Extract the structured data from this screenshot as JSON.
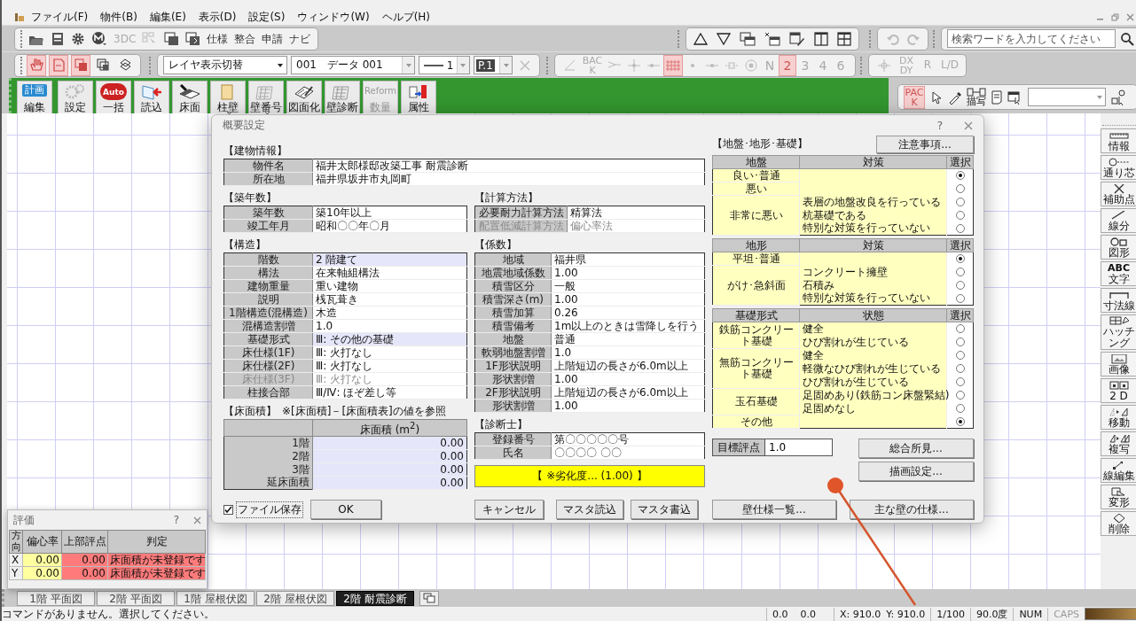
{
  "menu": {
    "items": [
      "ファイル(F)",
      "物件(B)",
      "編集(E)",
      "表示(D)",
      "設定(S)",
      "ウィンドウ(W)",
      "ヘルプ(H)"
    ]
  },
  "toolbar_top": {
    "text_buttons": [
      {
        "label": "3DC",
        "disabled": true
      },
      {
        "label": "仕様",
        "disabled": false
      },
      {
        "label": "整合",
        "disabled": false
      },
      {
        "label": "申請",
        "disabled": false
      },
      {
        "label": "ナビ",
        "disabled": false
      }
    ],
    "search": {
      "placeholder": "検索ワードを入力してください"
    }
  },
  "toolbar_second": {
    "mode_buttons": [
      {
        "selected": true
      },
      {
        "selected": true
      },
      {
        "selected": true
      },
      {
        "selected": false
      },
      {
        "selected": false
      }
    ],
    "layer_select": "レイヤ表示切替",
    "data_select": "001　データ 001",
    "line_select": "1",
    "page_select": "P.1",
    "snap_items": [
      {
        "kind": "icon",
        "selected": false
      },
      {
        "kind": "text",
        "label": "BACK",
        "selected": false
      },
      {
        "kind": "icon",
        "selected": false
      },
      {
        "kind": "icon",
        "selected": false
      },
      {
        "kind": "icon",
        "selected": false
      },
      {
        "kind": "icon",
        "selected": true
      },
      {
        "kind": "icon",
        "selected": false
      },
      {
        "kind": "icon",
        "selected": false
      },
      {
        "kind": "icon",
        "selected": false
      },
      {
        "kind": "icon",
        "selected": false
      },
      {
        "kind": "text",
        "label": "N",
        "selected": false
      },
      {
        "kind": "text",
        "label": "2",
        "selected": true
      },
      {
        "kind": "text",
        "label": "3",
        "selected": false
      },
      {
        "kind": "text",
        "label": "4",
        "selected": false
      },
      {
        "kind": "text",
        "label": "6",
        "selected": false
      }
    ],
    "offset_buttons": [
      "DX DY",
      "R",
      "L/D"
    ]
  },
  "ribbon": {
    "items": [
      {
        "label": "編集",
        "kind": "plan",
        "badge": "計画",
        "disabled": false,
        "dropdown": false
      },
      {
        "label": "設定",
        "kind": "icon",
        "disabled": false,
        "dropdown": false
      },
      {
        "label": "一括",
        "kind": "auto",
        "badge": "Auto",
        "disabled": false,
        "dropdown": false
      },
      {
        "label": "読込",
        "kind": "icon",
        "disabled": false,
        "dropdown": false
      },
      {
        "label": "床面",
        "kind": "icon",
        "disabled": false,
        "dropdown": false
      },
      {
        "label": "柱壁",
        "kind": "icon",
        "disabled": false,
        "dropdown": true
      },
      {
        "label": "壁番号",
        "kind": "icon",
        "disabled": false,
        "dropdown": true
      },
      {
        "label": "図面化",
        "kind": "icon",
        "disabled": false,
        "dropdown": false
      },
      {
        "label": "壁診断",
        "kind": "icon",
        "disabled": false,
        "dropdown": false
      },
      {
        "label": "数量",
        "kind": "reform",
        "badge": "Reform",
        "disabled": true,
        "dropdown": false
      },
      {
        "label": "属性",
        "kind": "icon",
        "disabled": false,
        "dropdown": false
      }
    ]
  },
  "ribbon_tools": {
    "pack": {
      "label": "PACK",
      "selected": true
    },
    "copy_label": "描写"
  },
  "dialog": {
    "title": "概要設定",
    "help": "?",
    "building_info": {
      "title": "【建物情報】",
      "rows": [
        {
          "label": "物件名",
          "value": "福井太郎様邸改築工事  耐震診断"
        },
        {
          "label": "所在地",
          "value": "福井県坂井市丸岡町"
        }
      ]
    },
    "age": {
      "title": "【築年数】",
      "rows": [
        {
          "label": "築年数",
          "value": "築10年以上"
        },
        {
          "label": "竣工年月",
          "value": "昭和〇〇年〇月"
        }
      ]
    },
    "calc_method": {
      "title": "【計算方法】",
      "rows": [
        {
          "label": "必要耐力計算方法",
          "value": "精算法",
          "disabled": false
        },
        {
          "label": "配置低減計算方法",
          "value": "偏心率法",
          "disabled": true
        }
      ]
    },
    "structure": {
      "title": "【構造】",
      "rows": [
        {
          "label": "階数",
          "value": "2 階建て",
          "selected": true,
          "disabled": false
        },
        {
          "label": "構法",
          "value": "在来軸組構法",
          "selected": false,
          "disabled": false
        },
        {
          "label": "建物重量",
          "value": "重い建物",
          "selected": false,
          "disabled": false
        },
        {
          "label": "説明",
          "value": "桟瓦葺き",
          "selected": false,
          "disabled": false
        },
        {
          "label": "1階構造(混構造)",
          "value": "木造",
          "selected": false,
          "disabled": false
        },
        {
          "label": "混構造割増",
          "value": "1.0",
          "selected": false,
          "disabled": false
        },
        {
          "label": "基礎形式",
          "value": "Ⅲ: その他の基礎",
          "selected": true,
          "disabled": false
        },
        {
          "label": "床仕様(1F)",
          "value": "Ⅲ: 火打なし",
          "selected": false,
          "disabled": false
        },
        {
          "label": "床仕様(2F)",
          "value": "Ⅲ: 火打なし",
          "selected": false,
          "disabled": false
        },
        {
          "label": "床仕様(3F)",
          "value": "Ⅲ: 火打なし",
          "selected": false,
          "disabled": true
        },
        {
          "label": "柱接合部",
          "value": "Ⅲ/Ⅳ: ほぞ差し等",
          "selected": false,
          "disabled": false
        }
      ]
    },
    "coefficients": {
      "title": "【係数】",
      "rows": [
        {
          "label": "地域",
          "value": "福井県"
        },
        {
          "label": "地震地域係数",
          "value": "1.00"
        },
        {
          "label": "積雪区分",
          "value": "一般"
        },
        {
          "label": "積雪深さ(m)",
          "value": "1.00"
        },
        {
          "label": "積雪加算",
          "value": "0.26"
        },
        {
          "label": "積雪備考",
          "value": "1m以上のときは雪降しを行う"
        },
        {
          "label": "地盤",
          "value": "普通"
        },
        {
          "label": "軟弱地盤割増",
          "value": "1.0"
        },
        {
          "label": "1F形状説明",
          "value": "上階短辺の長さが6.0m以上"
        },
        {
          "label": "形状割増",
          "value": "1.00"
        },
        {
          "label": "2F形状説明",
          "value": "上階短辺の長さが6.0m以上"
        },
        {
          "label": "形状割増",
          "value": "1.00"
        }
      ]
    },
    "floor_area": {
      "title": "【床面積】",
      "note": "※[床面積]－[床面積表]の値を参照",
      "header": "床面積 (m$^{2}$)",
      "rows": [
        {
          "label": "1階",
          "value": "0.00"
        },
        {
          "label": "2階",
          "value": "0.00"
        },
        {
          "label": "3階",
          "value": "0.00"
        },
        {
          "label": "延床面積",
          "value": "0.00"
        }
      ]
    },
    "inspector": {
      "title": "【診断士】",
      "rows": [
        {
          "label": "登録番号",
          "value": "第〇〇〇〇〇号"
        },
        {
          "label": "氏名",
          "value": "〇〇〇〇  〇〇"
        }
      ]
    },
    "deterioration": "【 ※劣化度... (1.00) 】",
    "foundation": {
      "title": "【地盤･地形･基礎】",
      "notes_button": "注意事項...",
      "tables": [
        {
          "headers": [
            "地盤",
            "対策",
            "選択"
          ],
          "groups": [
            {
              "label": "良い･普通",
              "rows": [
                {
                  "selected": true
                }
              ]
            },
            {
              "label": "悪い",
              "rows": [
                {
                  "selected": false
                }
              ]
            },
            {
              "label": "非常に悪い",
              "rows": [
                {
                  "text": "表層の地盤改良を行っている",
                  "selected": false
                },
                {
                  "text": "杭基礎である",
                  "selected": false
                },
                {
                  "text": "特別な対策を行っていない",
                  "selected": false
                }
              ]
            }
          ]
        },
        {
          "headers": [
            "地形",
            "対策",
            "選択"
          ],
          "groups": [
            {
              "label": "平坦･普通",
              "rows": [
                {
                  "selected": true
                }
              ]
            },
            {
              "label": "がけ･急斜面",
              "rows": [
                {
                  "text": "コンクリート擁壁",
                  "selected": false
                },
                {
                  "text": "石積み",
                  "selected": false
                },
                {
                  "text": "特別な対策を行っていない",
                  "selected": false
                }
              ]
            }
          ]
        },
        {
          "headers": [
            "基礎形式",
            "状態",
            "選択"
          ],
          "groups": [
            {
              "label": "鉄筋コンクリート基礎",
              "rows": [
                {
                  "text": "健全",
                  "selected": false
                },
                {
                  "text": "ひび割れが生じている",
                  "selected": false
                }
              ]
            },
            {
              "label": "無筋コンクリート基礎",
              "rows": [
                {
                  "text": "健全",
                  "selected": false
                },
                {
                  "text": "軽微なひび割れが生じている",
                  "selected": false
                },
                {
                  "text": "ひび割れが生じている",
                  "selected": false
                }
              ]
            },
            {
              "label": "玉石基礎",
              "rows": [
                {
                  "text": "足固めあり(鉄筋コン床盤緊結)",
                  "selected": false
                },
                {
                  "text": "足固めなし",
                  "selected": false
                }
              ]
            },
            {
              "label": "その他",
              "rows": [
                {
                  "selected": true
                }
              ]
            }
          ]
        }
      ]
    },
    "target_score": {
      "label": "目標評点",
      "value": "1.0"
    },
    "side_buttons": [
      "総合所見...",
      "描画設定..."
    ],
    "file_save": {
      "label": "ファイル保存",
      "checked": true
    },
    "buttons": {
      "ok": "OK",
      "cancel": "キャンセル",
      "master_load": "マスタ読込",
      "master_save": "マスタ書込",
      "wall_list": "壁仕様一覧...",
      "main_walls": "主な壁の仕様..."
    }
  },
  "side_tools": [
    {
      "label": "情報"
    },
    {
      "label": "通り芯"
    },
    {
      "label": "補助点"
    },
    {
      "label": "線分"
    },
    {
      "label": "図形"
    },
    {
      "label": "文字",
      "glyph": "ABC"
    },
    {
      "label": "寸法線"
    },
    {
      "label": "ハッチング"
    },
    {
      "label": "画像"
    },
    {
      "label": "2 D"
    },
    {
      "label": "移動"
    },
    {
      "label": "複写"
    },
    {
      "label": "線編集"
    },
    {
      "label": "変形"
    },
    {
      "label": "削除"
    }
  ],
  "evaluation": {
    "title": "評価",
    "help": "?",
    "headers": [
      "方向",
      "偏心率",
      "上部評点",
      "判定"
    ],
    "rows": [
      {
        "direction": "X",
        "eccentricity": "0.00",
        "score": "0.00",
        "judgement": "床面積が未登録です"
      },
      {
        "direction": "Y",
        "eccentricity": "0.00",
        "score": "0.00",
        "judgement": "床面積が未登録です"
      }
    ]
  },
  "sheet_tabs": [
    {
      "label": "1階 平面図",
      "selected": false
    },
    {
      "label": "2階 平面図",
      "selected": false
    },
    {
      "label": "1階 屋根伏図",
      "selected": false
    },
    {
      "label": "2階 屋根伏図",
      "selected": false
    },
    {
      "label": "2階 耐震診断",
      "selected": true
    }
  ],
  "status_bar": {
    "message": "コマンドがありません。選択してください。",
    "values": [
      "0.0",
      "0.0",
      "X: 910.0",
      "Y: 910.0",
      "1/100",
      "90.0度",
      "NUM"
    ],
    "caps": {
      "label": "CAPS",
      "on": false
    }
  }
}
